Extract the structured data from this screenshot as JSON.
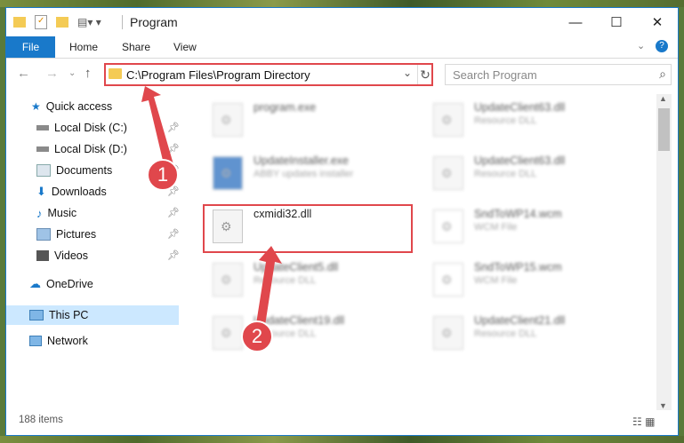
{
  "window": {
    "title": "Program",
    "controls": {
      "minimize": "—",
      "maximize": "☐",
      "close": "✕"
    }
  },
  "ribbon": {
    "file": "File",
    "tabs": [
      "Home",
      "Share",
      "View"
    ]
  },
  "address": {
    "path": "C:\\Program Files\\Program Directory"
  },
  "search": {
    "placeholder": "Search Program"
  },
  "sidebar": {
    "items": [
      {
        "label": "Quick access",
        "icon": "star-icon"
      },
      {
        "label": "Local Disk (C:)",
        "icon": "drive-icon"
      },
      {
        "label": "Local Disk (D:)",
        "icon": "drive-icon"
      },
      {
        "label": "Documents",
        "icon": "documents-icon"
      },
      {
        "label": "Downloads",
        "icon": "download-icon"
      },
      {
        "label": "Music",
        "icon": "music-icon"
      },
      {
        "label": "Pictures",
        "icon": "pictures-icon"
      },
      {
        "label": "Videos",
        "icon": "videos-icon"
      },
      {
        "label": "OneDrive",
        "icon": "cloud-icon"
      },
      {
        "label": "This PC",
        "icon": "computer-icon"
      },
      {
        "label": "Network",
        "icon": "network-icon"
      }
    ]
  },
  "files": [
    {
      "name": "program.exe",
      "type": ""
    },
    {
      "name": "UpdateClient63.dll",
      "type": "Resource DLL"
    },
    {
      "name": "UpdateInstaller.exe",
      "type": "ABBY updates installer"
    },
    {
      "name": "UpdateClient63.dll",
      "type": "Resource DLL"
    },
    {
      "name": "cxmidi32.dll",
      "type": ""
    },
    {
      "name": "SndToWP14.wcm",
      "type": "WCM File"
    },
    {
      "name": "UpdateClient5.dll",
      "type": "Resource DLL"
    },
    {
      "name": "SndToWP15.wcm",
      "type": "WCM File"
    },
    {
      "name": "UpdateClient19.dll",
      "type": "Resource DLL"
    },
    {
      "name": "UpdateClient21.dll",
      "type": "Resource DLL"
    }
  ],
  "status": {
    "items": "188 items"
  },
  "markers": {
    "one": "1",
    "two": "2"
  },
  "colors": {
    "accent": "#1979ca",
    "highlight": "#e0474c"
  }
}
